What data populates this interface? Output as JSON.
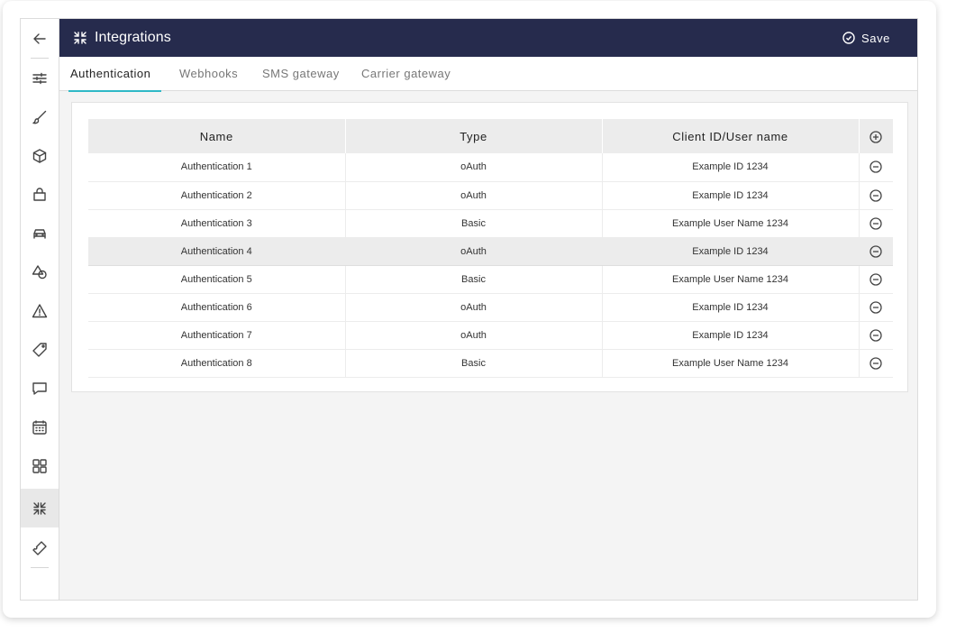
{
  "header": {
    "title": "Integrations",
    "save_label": "Save"
  },
  "tabs": [
    {
      "label": "Authentication",
      "active": true
    },
    {
      "label": "Webhooks",
      "active": false
    },
    {
      "label": "SMS gateway",
      "active": false
    },
    {
      "label": "Carrier gateway",
      "active": false
    }
  ],
  "sidebar": {
    "items": [
      "back-arrow-icon",
      "sliders-icon",
      "brush-icon",
      "cube-icon",
      "shopping-bag-icon",
      "car-icon",
      "shapes-icon",
      "warning-icon",
      "tag-icon",
      "chat-icon",
      "calendar-icon",
      "grid-icon",
      "integrations-icon",
      "ticket-icon"
    ],
    "active": "integrations-icon"
  },
  "table": {
    "columns": [
      "Name",
      "Type",
      "Client ID/User name"
    ],
    "rows": [
      {
        "name": "Authentication 1",
        "type": "oAuth",
        "client": "Example ID 1234"
      },
      {
        "name": "Authentication 2",
        "type": "oAuth",
        "client": "Example ID 1234"
      },
      {
        "name": "Authentication 3",
        "type": "Basic",
        "client": "Example User Name 1234"
      },
      {
        "name": "Authentication 4",
        "type": "oAuth",
        "client": "Example ID 1234"
      },
      {
        "name": "Authentication 5",
        "type": "Basic",
        "client": "Example User Name 1234"
      },
      {
        "name": "Authentication 6",
        "type": "oAuth",
        "client": "Example ID 1234"
      },
      {
        "name": "Authentication 7",
        "type": "oAuth",
        "client": "Example ID 1234"
      },
      {
        "name": "Authentication 8",
        "type": "Basic",
        "client": "Example User Name 1234"
      }
    ],
    "highlighted_row": 4
  },
  "colors": {
    "header_bg": "#262b4d",
    "tab_accent": "#2fb8c6",
    "page_bg": "#f4f4f4"
  }
}
